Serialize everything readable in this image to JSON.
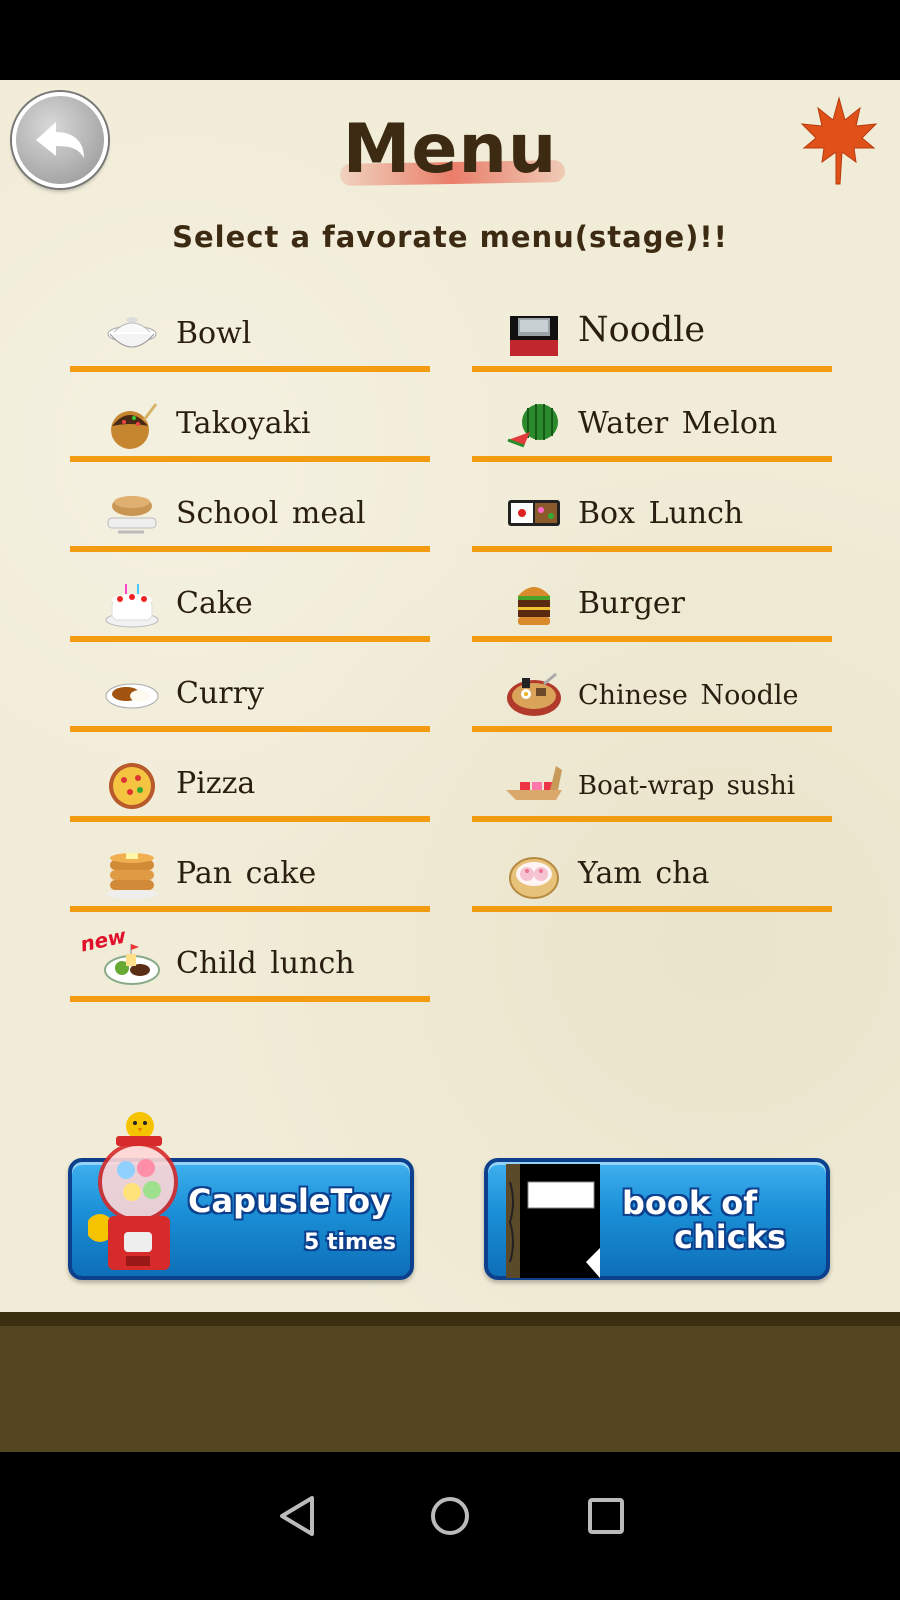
{
  "header": {
    "title": "Menu",
    "subtitle": "Select a favorate menu(stage)!!",
    "back_icon": "back-arrow-icon",
    "leaf_icon": "maple-leaf-icon"
  },
  "menu": {
    "left": [
      {
        "label": "Bowl",
        "icon": "bowl-icon"
      },
      {
        "label": "Takoyaki",
        "icon": "takoyaki-icon"
      },
      {
        "label": "School meal",
        "icon": "school-meal-icon"
      },
      {
        "label": "Cake",
        "icon": "cake-icon"
      },
      {
        "label": "Curry",
        "icon": "curry-icon"
      },
      {
        "label": "Pizza",
        "icon": "pizza-icon"
      },
      {
        "label": "Pan cake",
        "icon": "pancake-icon"
      },
      {
        "label": "Child lunch",
        "icon": "child-lunch-icon",
        "badge": "new"
      }
    ],
    "right": [
      {
        "label": "Noodle",
        "icon": "noodle-icon"
      },
      {
        "label": "Water Melon",
        "icon": "watermelon-icon"
      },
      {
        "label": "Box Lunch",
        "icon": "box-lunch-icon"
      },
      {
        "label": "Burger",
        "icon": "burger-icon"
      },
      {
        "label": "Chinese Noodle",
        "icon": "ramen-icon"
      },
      {
        "label": "Boat-wrap sushi",
        "icon": "sushi-boat-icon"
      },
      {
        "label": "Yam cha",
        "icon": "yum-cha-icon"
      }
    ]
  },
  "buttons": {
    "capsule": {
      "label": "CapusleToy",
      "count": "5 times",
      "icon": "gumball-machine-icon"
    },
    "book": {
      "line1": "book of",
      "line2": "chicks",
      "icon": "notebook-icon"
    }
  },
  "nav": {
    "back": "nav-back-icon",
    "home": "nav-home-icon",
    "recents": "nav-recents-icon"
  },
  "colors": {
    "background": "#f1ecd7",
    "underline": "#f39c12",
    "button": "#1a8fd6",
    "band": "#534620"
  }
}
